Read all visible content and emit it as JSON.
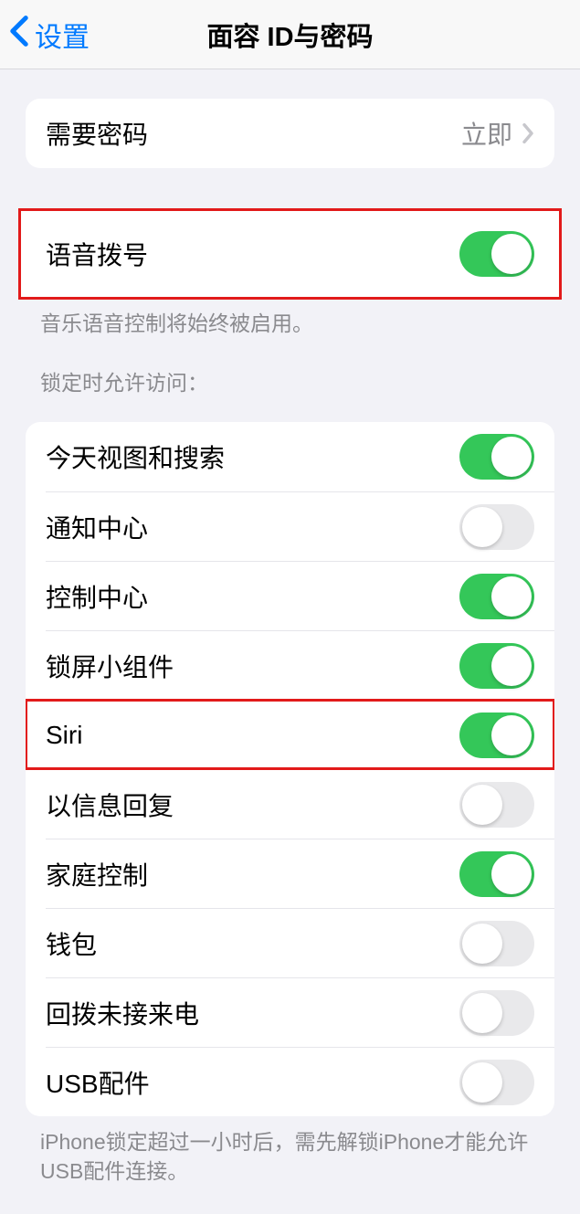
{
  "nav": {
    "back_label": "设置",
    "title": "面容 ID与密码"
  },
  "group_require_passcode": {
    "label": "需要密码",
    "value": "立即"
  },
  "group_voice_dial": {
    "label": "语音拨号",
    "on": true,
    "footer": "音乐语音控制将始终被启用。"
  },
  "lock_access": {
    "header": "锁定时允许访问：",
    "items": [
      {
        "label": "今天视图和搜索",
        "on": true
      },
      {
        "label": "通知中心",
        "on": false
      },
      {
        "label": "控制中心",
        "on": true
      },
      {
        "label": "锁屏小组件",
        "on": true
      },
      {
        "label": "Siri",
        "on": true,
        "highlight": true
      },
      {
        "label": "以信息回复",
        "on": false
      },
      {
        "label": "家庭控制",
        "on": true
      },
      {
        "label": "钱包",
        "on": false
      },
      {
        "label": "回拨未接来电",
        "on": false
      },
      {
        "label": "USB配件",
        "on": false
      }
    ],
    "footer": "iPhone锁定超过一小时后，需先解锁iPhone才能允许USB配件连接。"
  }
}
